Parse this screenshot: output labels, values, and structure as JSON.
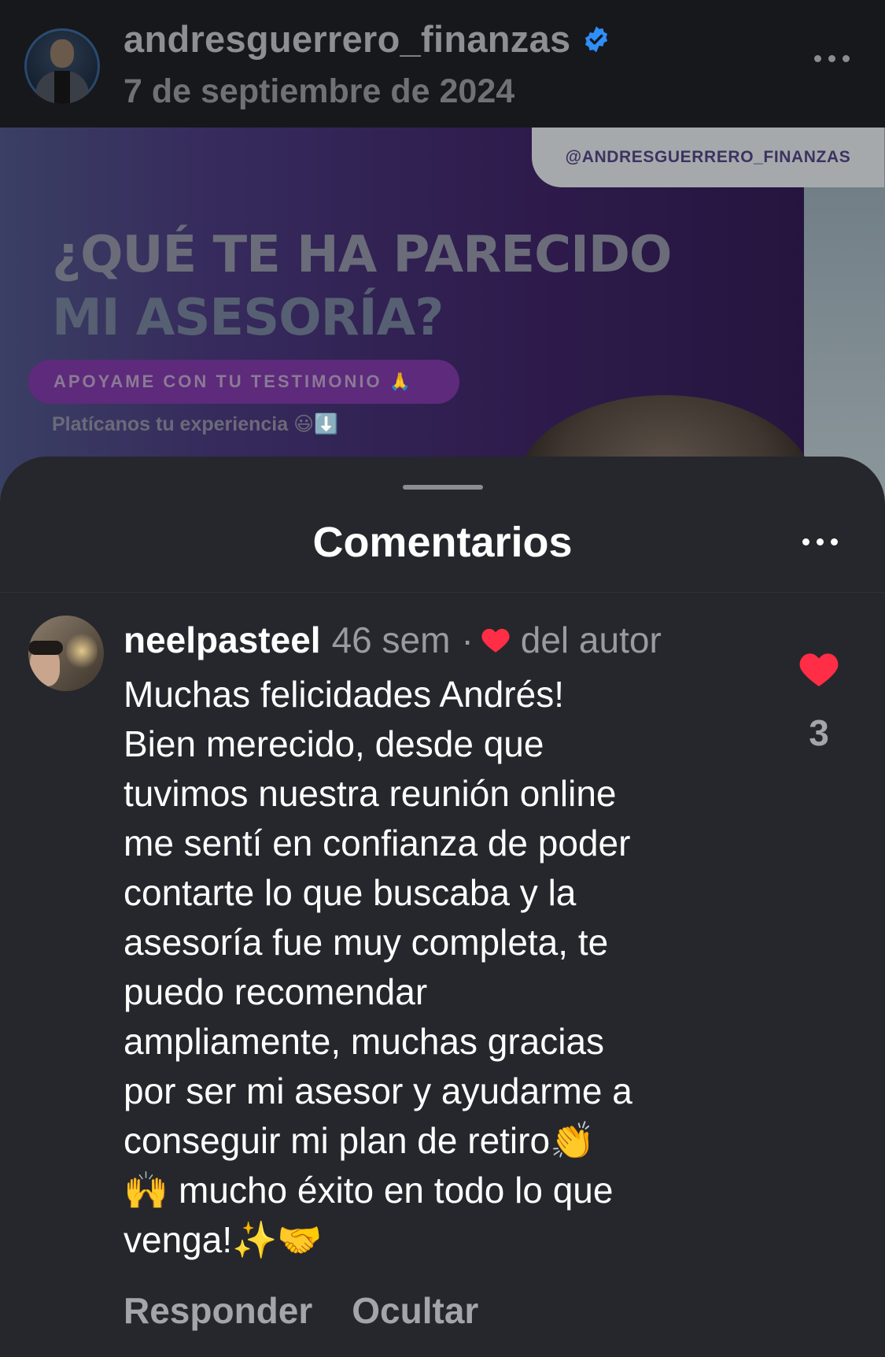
{
  "post": {
    "username": "andresguerrero_finanzas",
    "date": "7 de septiembre de 2024",
    "image": {
      "handle_tag": "@ANDRESGUERRERO_FINANZAS",
      "headline_line1": "¿QUÉ TE HA PARECIDO",
      "headline_line2": "MI ASESORÍA?",
      "cta": "APOYAME CON TU TESTIMONIO 🙏",
      "subtext": "Platícanos tu experiencia 😃⬇️"
    }
  },
  "sheet": {
    "title": "Comentarios"
  },
  "comment": {
    "username": "neelpasteel",
    "time": "46 sem",
    "separator": "·",
    "author_label": "del autor",
    "text": "Muchas felicidades Andrés!\nBien merecido, desde que\ntuvimos nuestra reunión online\nme sentí en confianza de poder\ncontarte lo que buscaba y la\nasesoría fue muy completa, te\npuedo recomendar\nampliamente, muchas gracias\npor ser mi asesor y ayudarme a\nconseguir mi plan de retiro👏\n🙌 mucho éxito en todo lo que\nvenga!✨🤝",
    "likes": "3",
    "reply_label": "Responder",
    "hide_label": "Ocultar"
  },
  "colors": {
    "sheet_background": "#26272c",
    "like_red": "#ff2d45",
    "verified_blue": "#2f8ef7",
    "secondary_text": "#9a9ba1"
  },
  "icons": [
    "verified-badge-icon",
    "more-options-icon",
    "heart-icon"
  ]
}
